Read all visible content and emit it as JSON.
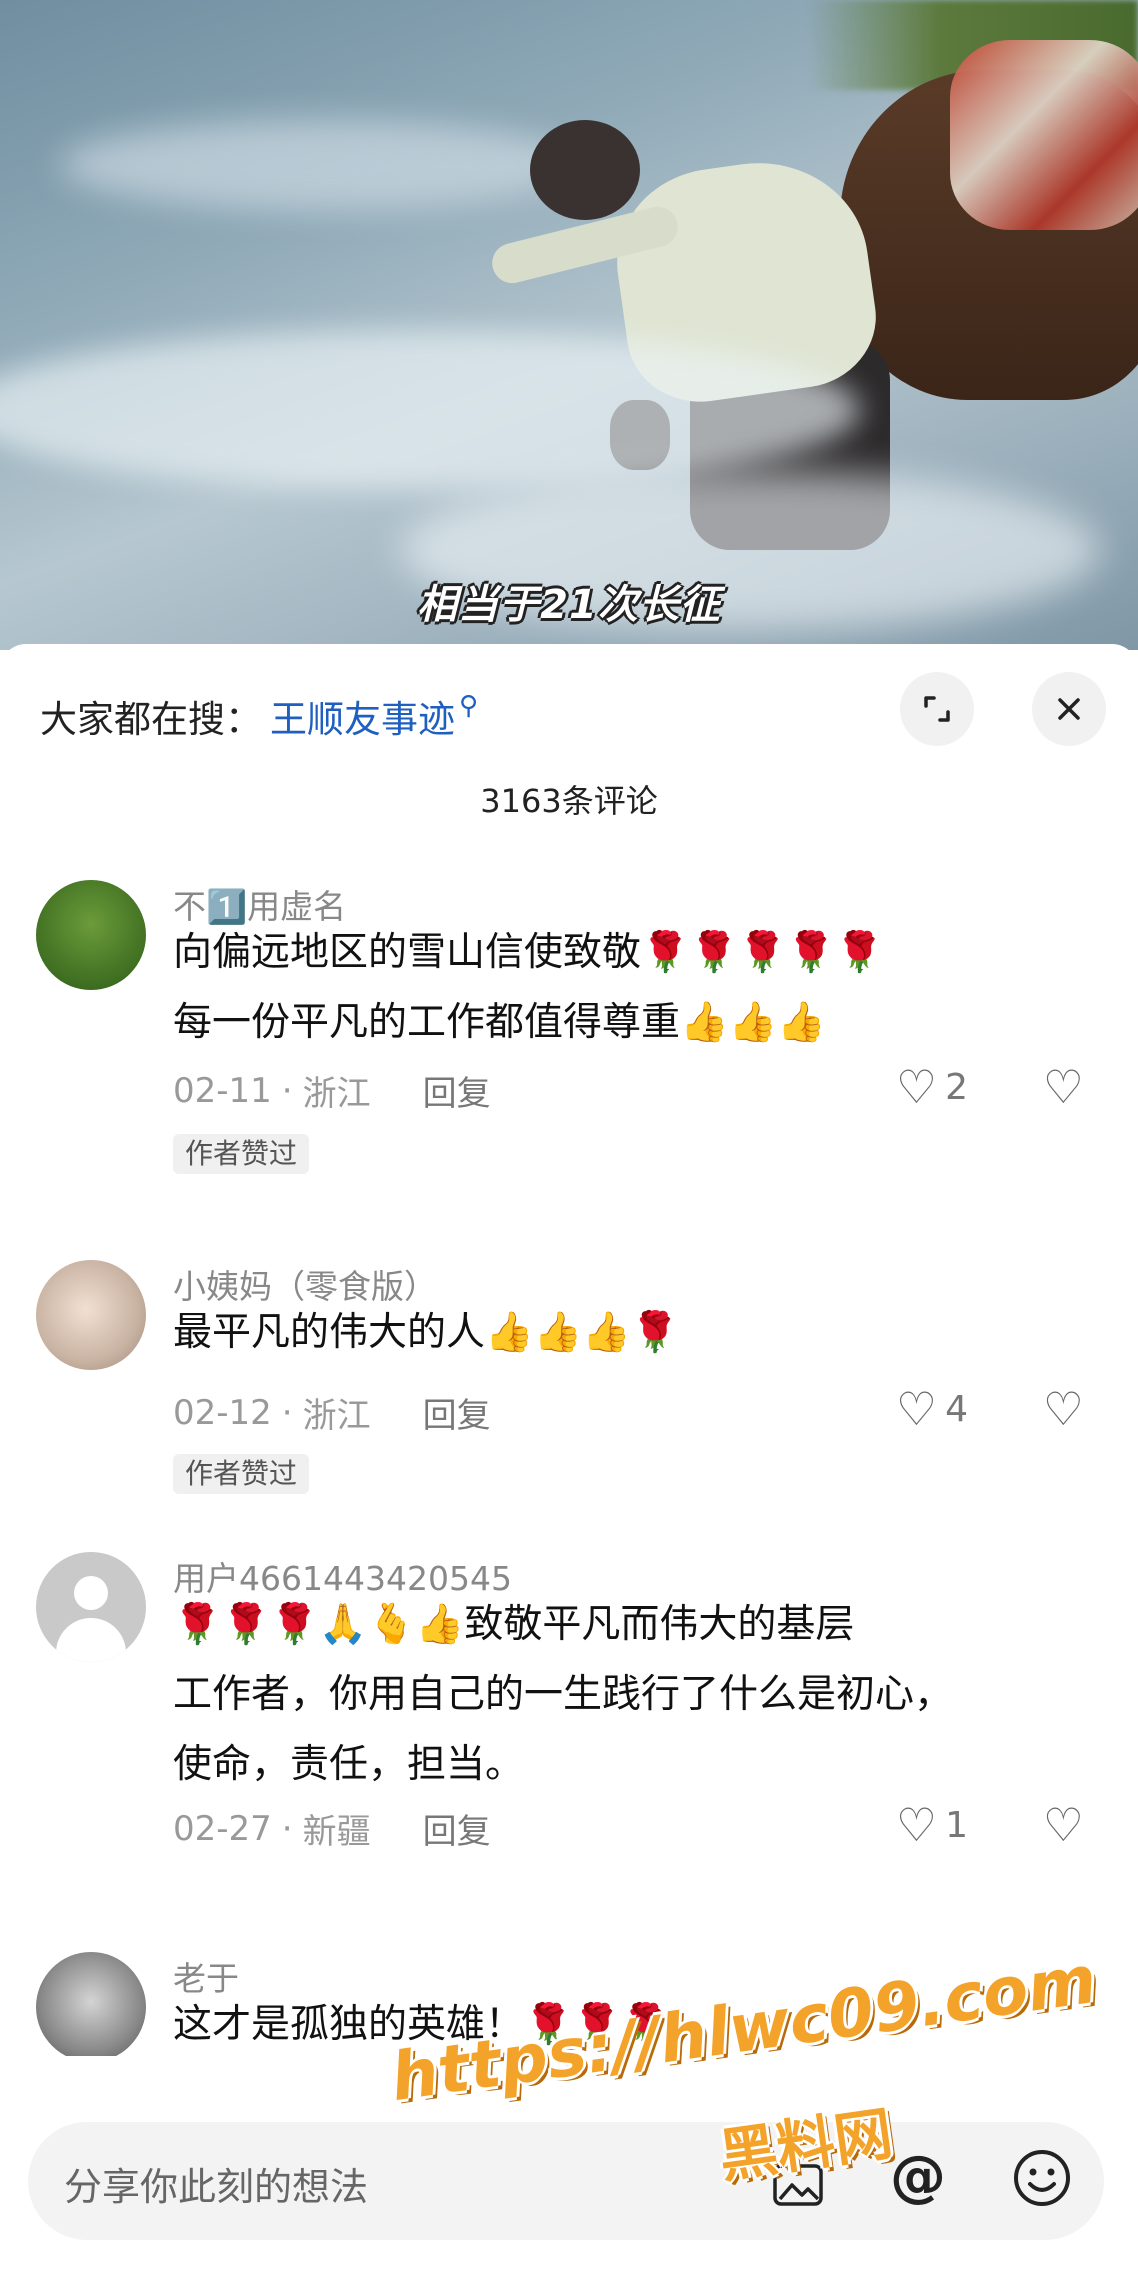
{
  "video": {
    "caption": "相当于21次长征"
  },
  "header": {
    "search_prefix": "大家都在搜：",
    "search_keyword": "王顺友事迹",
    "search_icon": "search-icon",
    "expand_icon": "expand-icon",
    "close_icon": "close-icon",
    "comment_count": "3163条评论"
  },
  "comments": [
    {
      "username": "不1️⃣用虚名",
      "lines": [
        "向偏远地区的雪山信使致敬🌹🌹🌹🌹🌹",
        "每一份平凡的工作都值得尊重👍👍👍"
      ],
      "date": "02-11",
      "location": "浙江",
      "reply": "回复",
      "likes": "2",
      "badge": "作者赞过"
    },
    {
      "username": "小姨妈（零食版）",
      "lines": [
        "最平凡的伟大的人👍👍👍🌹"
      ],
      "date": "02-12",
      "location": "浙江",
      "reply": "回复",
      "likes": "4",
      "badge": "作者赞过"
    },
    {
      "username": "用户4661443420545",
      "lines": [
        "🌹🌹🌹🙏🫰👍致敬平凡而伟大的基层",
        "工作者，你用自己的一生践行了什么是初心，",
        "使命，责任，担当。"
      ],
      "date": "02-27",
      "location": "新疆",
      "reply": "回复",
      "likes": "1"
    },
    {
      "username": "老于",
      "lines": [
        "这才是孤独的英雄！🌹🌹🌹"
      ]
    }
  ],
  "input": {
    "placeholder": "分享你此刻的想法",
    "image_icon": "image-icon",
    "at_icon": "at-icon",
    "emoji_icon": "emoji-icon"
  },
  "watermark": {
    "url": "https://hlwc09.com",
    "text": "黑料网"
  }
}
